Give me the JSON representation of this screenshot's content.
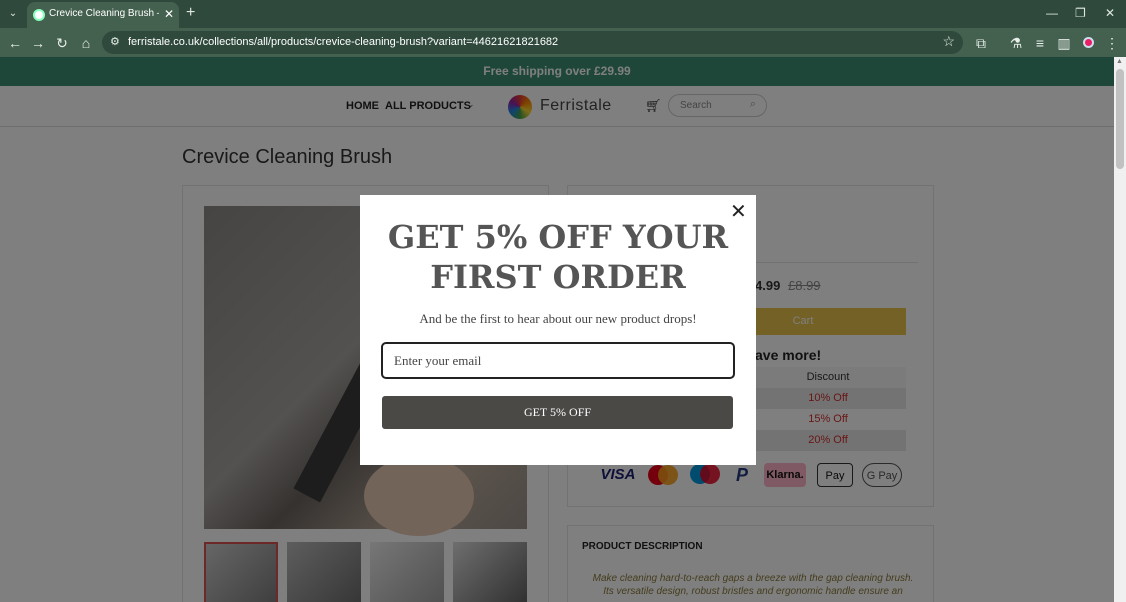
{
  "browser": {
    "tab_title": "Crevice Cleaning Brush – ferristale",
    "url": "ferristale.co.uk/collections/all/products/crevice-cleaning-brush?variant=44621621821682"
  },
  "site": {
    "announcement": "Free shipping over £29.99",
    "nav": {
      "home": "HOME",
      "all_products": "ALL PRODUCTS"
    },
    "logo_text": "Ferristale",
    "search_placeholder": "Search"
  },
  "product": {
    "title": "Crevice Cleaning Brush",
    "price_visible": "4.99",
    "price_old": "£8.99",
    "add_to_cart_visible": "Cart",
    "save_more_visible": "ave more!",
    "discount_header": "Discount",
    "discounts": [
      "10% Off",
      "15% Off",
      "20% Off"
    ],
    "payment_methods": [
      "VISA",
      "",
      "",
      "",
      "Klarna.",
      " Pay",
      "G Pay"
    ],
    "description_title": "PRODUCT DESCRIPTION",
    "description_text": "Make cleaning hard-to-reach gaps a breeze with the gap cleaning brush. Its versatile design, robust bristles and ergonomic handle ensure an"
  },
  "modal": {
    "heading": "GET 5% OFF YOUR FIRST ORDER",
    "subtext": "And be the first to hear about our new product drops!",
    "email_placeholder": "Enter your email",
    "button_label": "GET 5% OFF",
    "close_symbol": "✕"
  },
  "icons": {
    "back": "back-arrow-icon",
    "forward": "forward-arrow-icon",
    "reload": "reload-icon",
    "home": "home-icon",
    "cart": "cart-icon",
    "search": "search-icon",
    "close": "close-icon"
  },
  "colors": {
    "announcement_bg": "#3d8f74",
    "add_to_cart_bg": "#e8c34a",
    "discount_text": "#d32f2f",
    "cta_bg": "#4b4945"
  }
}
